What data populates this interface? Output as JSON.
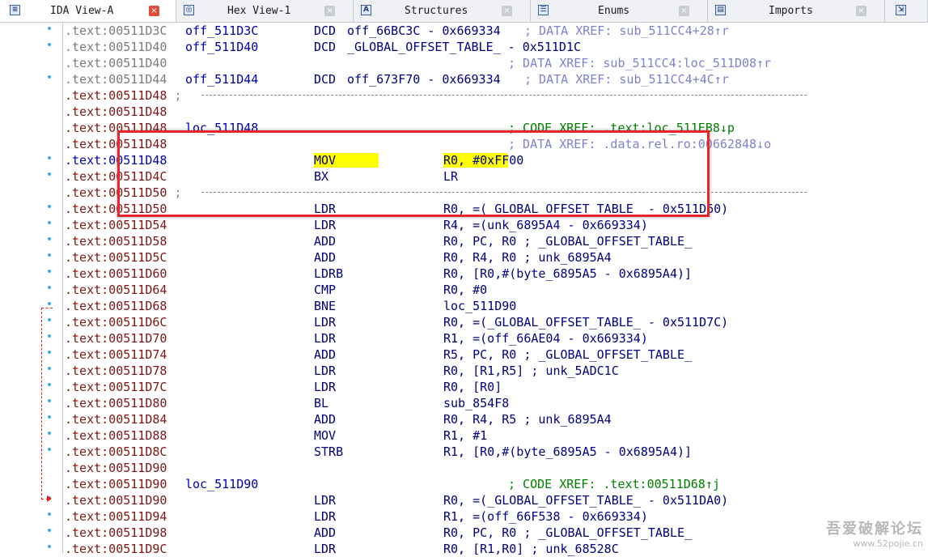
{
  "tabs": [
    {
      "label": "IDA View-A",
      "icon": "list-view-icon",
      "active": true
    },
    {
      "label": "Hex View-1",
      "icon": "hex-view-icon",
      "active": false
    },
    {
      "label": "Structures",
      "icon": "structures-icon",
      "active": false
    },
    {
      "label": "Enums",
      "icon": "enums-icon",
      "active": false
    },
    {
      "label": "Imports",
      "icon": "imports-icon",
      "active": false
    },
    {
      "label": "",
      "icon": "exports-icon",
      "active": false
    }
  ],
  "lines": [
    {
      "addr": ".text:00511D3C",
      "kind": "data",
      "bullet": true,
      "name": "off_511D3C",
      "mnem": "DCD",
      "ops": "off_66BC3C - 0x669334",
      "cmt": "; DATA XREF: sub_511CC4+28↑r"
    },
    {
      "addr": ".text:00511D40",
      "kind": "data",
      "bullet": true,
      "name": "off_511D40",
      "mnem": "DCD",
      "ops": "_GLOBAL_OFFSET_TABLE_ - 0x511D1C",
      "cmt": ""
    },
    {
      "addr": ".text:00511D40",
      "kind": "data",
      "bullet": false,
      "name": "",
      "mnem": "",
      "ops": "",
      "cmt": "; DATA XREF: sub_511CC4:loc_511D08↑r"
    },
    {
      "addr": ".text:00511D44",
      "kind": "data",
      "bullet": true,
      "name": "off_511D44",
      "mnem": "DCD",
      "ops": "off_673F70 - 0x669334",
      "cmt": "; DATA XREF: sub_511CC4+4C↑r"
    },
    {
      "addr": ".text:00511D48",
      "kind": "code",
      "bullet": false,
      "sep": true,
      "name": "",
      "mnem": "",
      "ops": "",
      "cmt": ""
    },
    {
      "addr": ".text:00511D48",
      "kind": "code",
      "bullet": false,
      "name": "",
      "mnem": "",
      "ops": "",
      "cmt": ""
    },
    {
      "addr": ".text:00511D48",
      "kind": "code",
      "bullet": false,
      "name": "loc_511D48",
      "mnem": "",
      "ops": "",
      "cmt": "; CODE XREF: .text:loc_511EB8↓p"
    },
    {
      "addr": ".text:00511D48",
      "kind": "code",
      "bullet": false,
      "name": "",
      "mnem": "",
      "ops": "",
      "cmt": "; DATA XREF: .data.rel.ro:00662848↓o"
    },
    {
      "addr": ".text:00511D48",
      "kind": "current",
      "bullet": true,
      "name": "",
      "mnem": "MOV",
      "ops": "R0, #0xFF00",
      "cmt": "",
      "highlight": true
    },
    {
      "addr": ".text:00511D4C",
      "kind": "code",
      "bullet": true,
      "name": "",
      "mnem": "BX",
      "ops": "LR",
      "cmt": ""
    },
    {
      "addr": ".text:00511D50",
      "kind": "code",
      "bullet": false,
      "sep": true,
      "name": "",
      "mnem": "",
      "ops": "",
      "cmt": ""
    },
    {
      "addr": ".text:00511D50",
      "kind": "code",
      "bullet": true,
      "name": "",
      "mnem": "LDR",
      "ops": "R0, =(_GLOBAL_OFFSET_TABLE_ - 0x511D60)",
      "cmt": ""
    },
    {
      "addr": ".text:00511D54",
      "kind": "code",
      "bullet": true,
      "name": "",
      "mnem": "LDR",
      "ops": "R4, =(unk_6895A4 - 0x669334)",
      "cmt": ""
    },
    {
      "addr": ".text:00511D58",
      "kind": "code",
      "bullet": true,
      "name": "",
      "mnem": "ADD",
      "ops": "R0, PC, R0 ; _GLOBAL_OFFSET_TABLE_",
      "cmt": ""
    },
    {
      "addr": ".text:00511D5C",
      "kind": "code",
      "bullet": true,
      "name": "",
      "mnem": "ADD",
      "ops": "R0, R4, R0 ; unk_6895A4",
      "cmt": ""
    },
    {
      "addr": ".text:00511D60",
      "kind": "code",
      "bullet": true,
      "name": "",
      "mnem": "LDRB",
      "ops": "R0, [R0,#(byte_6895A5 - 0x6895A4)]",
      "cmt": ""
    },
    {
      "addr": ".text:00511D64",
      "kind": "code",
      "bullet": true,
      "name": "",
      "mnem": "CMP",
      "ops": "R0, #0",
      "cmt": ""
    },
    {
      "addr": ".text:00511D68",
      "kind": "code",
      "bullet": true,
      "name": "",
      "mnem": "BNE",
      "ops": "loc_511D90",
      "cmt": ""
    },
    {
      "addr": ".text:00511D6C",
      "kind": "code",
      "bullet": true,
      "name": "",
      "mnem": "LDR",
      "ops": "R0, =(_GLOBAL_OFFSET_TABLE_ - 0x511D7C)",
      "cmt": ""
    },
    {
      "addr": ".text:00511D70",
      "kind": "code",
      "bullet": true,
      "name": "",
      "mnem": "LDR",
      "ops": "R1, =(off_66AE04 - 0x669334)",
      "cmt": ""
    },
    {
      "addr": ".text:00511D74",
      "kind": "code",
      "bullet": true,
      "name": "",
      "mnem": "ADD",
      "ops": "R5, PC, R0 ; _GLOBAL_OFFSET_TABLE_",
      "cmt": ""
    },
    {
      "addr": ".text:00511D78",
      "kind": "code",
      "bullet": true,
      "name": "",
      "mnem": "LDR",
      "ops": "R0, [R1,R5] ; unk_5ADC1C",
      "cmt": ""
    },
    {
      "addr": ".text:00511D7C",
      "kind": "code",
      "bullet": true,
      "name": "",
      "mnem": "LDR",
      "ops": "R0, [R0]",
      "cmt": ""
    },
    {
      "addr": ".text:00511D80",
      "kind": "code",
      "bullet": true,
      "name": "",
      "mnem": "BL",
      "ops": "sub_854F8",
      "cmt": ""
    },
    {
      "addr": ".text:00511D84",
      "kind": "code",
      "bullet": true,
      "name": "",
      "mnem": "ADD",
      "ops": "R0, R4, R5 ; unk_6895A4",
      "cmt": ""
    },
    {
      "addr": ".text:00511D88",
      "kind": "code",
      "bullet": true,
      "name": "",
      "mnem": "MOV",
      "ops": "R1, #1",
      "cmt": ""
    },
    {
      "addr": ".text:00511D8C",
      "kind": "code",
      "bullet": true,
      "name": "",
      "mnem": "STRB",
      "ops": "R1, [R0,#(byte_6895A5 - 0x6895A4)]",
      "cmt": ""
    },
    {
      "addr": ".text:00511D90",
      "kind": "code",
      "bullet": false,
      "name": "",
      "mnem": "",
      "ops": "",
      "cmt": ""
    },
    {
      "addr": ".text:00511D90",
      "kind": "code",
      "bullet": false,
      "name": "loc_511D90",
      "mnem": "",
      "ops": "",
      "cmt": "; CODE XREF: .text:00511D68↑j"
    },
    {
      "addr": ".text:00511D90",
      "kind": "code",
      "bullet": true,
      "name": "",
      "mnem": "LDR",
      "ops": "R0, =(_GLOBAL_OFFSET_TABLE_ - 0x511DA0)",
      "cmt": ""
    },
    {
      "addr": ".text:00511D94",
      "kind": "code",
      "bullet": true,
      "name": "",
      "mnem": "LDR",
      "ops": "R1, =(off_66F538 - 0x669334)",
      "cmt": ""
    },
    {
      "addr": ".text:00511D98",
      "kind": "code",
      "bullet": true,
      "name": "",
      "mnem": "ADD",
      "ops": "R0, PC, R0 ; _GLOBAL_OFFSET_TABLE_",
      "cmt": ""
    },
    {
      "addr": ".text:00511D9C",
      "kind": "code",
      "bullet": true,
      "name": "",
      "mnem": "LDR",
      "ops": "R0, [R1,R0] ; unk_68528C",
      "cmt": ""
    }
  ],
  "colors": {
    "annotation_box": "#e8262a",
    "highlight": "#ffff00",
    "branch_arrow": "#e02020",
    "bullet": "#38a9e8"
  },
  "watermark": {
    "title": "吾爱破解论坛",
    "url": "www.52pojie.cn"
  }
}
